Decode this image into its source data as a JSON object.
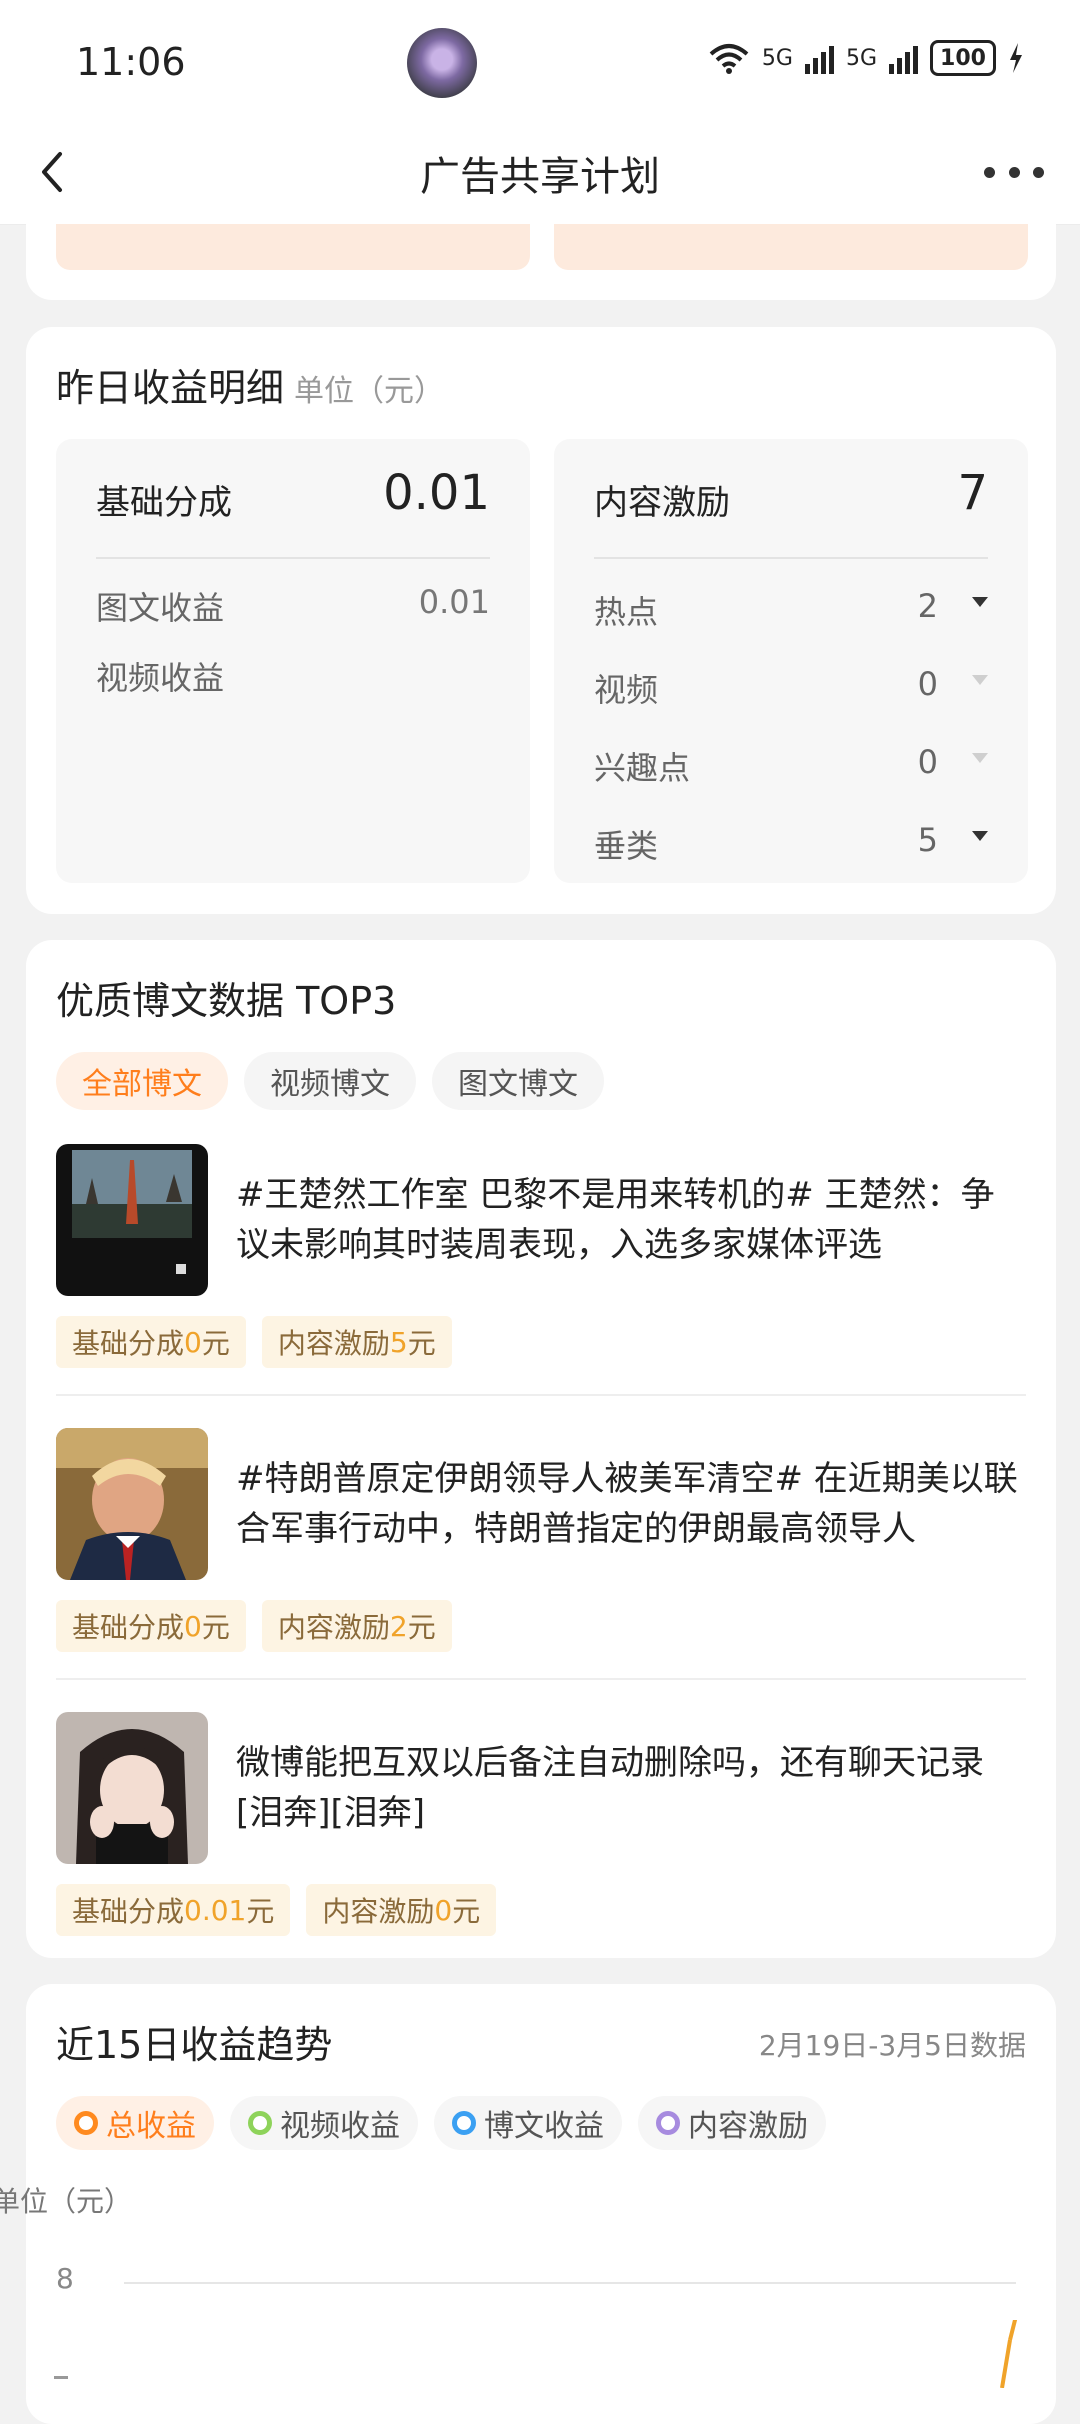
{
  "status": {
    "time": "11:06",
    "net1": "5G",
    "net2": "5G",
    "battery": "100"
  },
  "nav": {
    "title": "广告共享计划"
  },
  "yesterday": {
    "title": "昨日收益明细",
    "unit": "单位（元）",
    "basic": {
      "label": "基础分成",
      "value": "0.01",
      "rows": [
        {
          "label": "图文收益",
          "value": "0.01"
        },
        {
          "label": "视频收益",
          "value": ""
        }
      ]
    },
    "content": {
      "label": "内容激励",
      "value": "7",
      "rows": [
        {
          "label": "热点",
          "value": "2"
        },
        {
          "label": "视频",
          "value": "0"
        },
        {
          "label": "兴趣点",
          "value": "0"
        },
        {
          "label": "垂类",
          "value": "5"
        }
      ]
    }
  },
  "top3": {
    "title": "优质博文数据 TOP3",
    "tabs": [
      "全部博文",
      "视频博文",
      "图文博文"
    ],
    "posts": [
      {
        "text": "#王楚然工作室 巴黎不是用来转机的# 王楚然：争议未影响其时装周表现，入选多家媒体评选",
        "basic_label": "基础分成",
        "basic_value": "0",
        "content_label": "内容激励",
        "content_value": "5",
        "yuan": "元"
      },
      {
        "text": "#特朗普原定伊朗领导人被美军清空# 在近期美以联合军事行动中，特朗普指定的伊朗最高领导人",
        "basic_label": "基础分成",
        "basic_value": "0",
        "content_label": "内容激励",
        "content_value": "2",
        "yuan": "元"
      },
      {
        "text": "微博能把互双以后备注自动删除吗，还有聊天记录[泪奔][泪奔]",
        "basic_label": "基础分成",
        "basic_value": "0.01",
        "content_label": "内容激励",
        "content_value": "0",
        "yuan": "元"
      }
    ]
  },
  "trend": {
    "title": "近15日收益趋势",
    "range": "2月19日-3月5日数据",
    "legend": [
      {
        "label": "总收益",
        "color": "#ff8a1f"
      },
      {
        "label": "视频收益",
        "color": "#8ed35a"
      },
      {
        "label": "博文收益",
        "color": "#3ba0f2"
      },
      {
        "label": "内容激励",
        "color": "#a78bdf"
      }
    ],
    "unit": "单位（元）",
    "y_tick_top": "8"
  }
}
